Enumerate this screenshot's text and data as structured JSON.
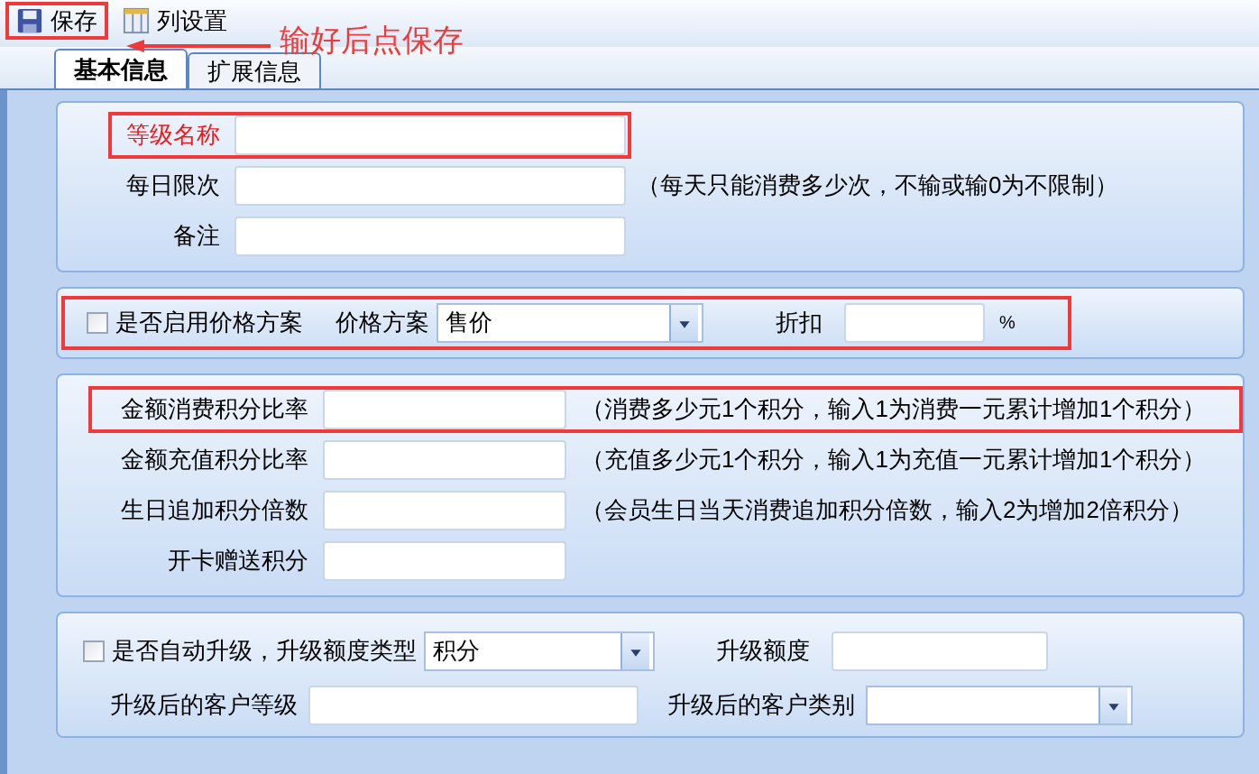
{
  "toolbar": {
    "buttons": [
      {
        "label": "保存",
        "kind": "save",
        "highlighted": true
      },
      {
        "label": "列设置",
        "kind": "columns",
        "highlighted": false
      }
    ]
  },
  "annotation": {
    "text": "输好后点保存"
  },
  "tabs": [
    {
      "label": "基本信息",
      "selected": true
    },
    {
      "label": "扩展信息",
      "selected": false
    }
  ],
  "basic": {
    "fields": [
      {
        "label": "等级名称",
        "highlighted": true
      },
      {
        "label": "每日限次",
        "highlighted": false,
        "hint": "（每天只能消费多少次，不输或输0为不限制）"
      },
      {
        "label": "备注",
        "highlighted": false
      }
    ]
  },
  "price": {
    "highlighted": true,
    "enable": {
      "label": "是否启用价格方案",
      "checked": false
    },
    "scheme": {
      "label": "价格方案",
      "value": "售价"
    },
    "discount": {
      "label": "折扣",
      "unit": "%"
    }
  },
  "points": {
    "fields": [
      {
        "label": "金额消费积分比率",
        "highlighted": true,
        "hint": "（消费多少元1个积分，输入1为消费一元累计增加1个积分）"
      },
      {
        "label": "金额充值积分比率",
        "highlighted": false,
        "hint": "（充值多少元1个积分，输入1为充值一元累计增加1个积分）"
      },
      {
        "label": "生日追加积分倍数",
        "highlighted": false,
        "hint": "（会员生日当天消费追加积分倍数，输入2为增加2倍积分）"
      },
      {
        "label": "开卡赠送积分",
        "highlighted": false
      }
    ]
  },
  "upgrade": {
    "auto": {
      "label": "是否自动升级，升级额度类型",
      "checked": false
    },
    "amount_type": {
      "value": "积分"
    },
    "amount": {
      "label": "升级额度"
    },
    "level": {
      "label": "升级后的客户等级"
    },
    "category": {
      "label": "升级后的客户类别"
    }
  }
}
